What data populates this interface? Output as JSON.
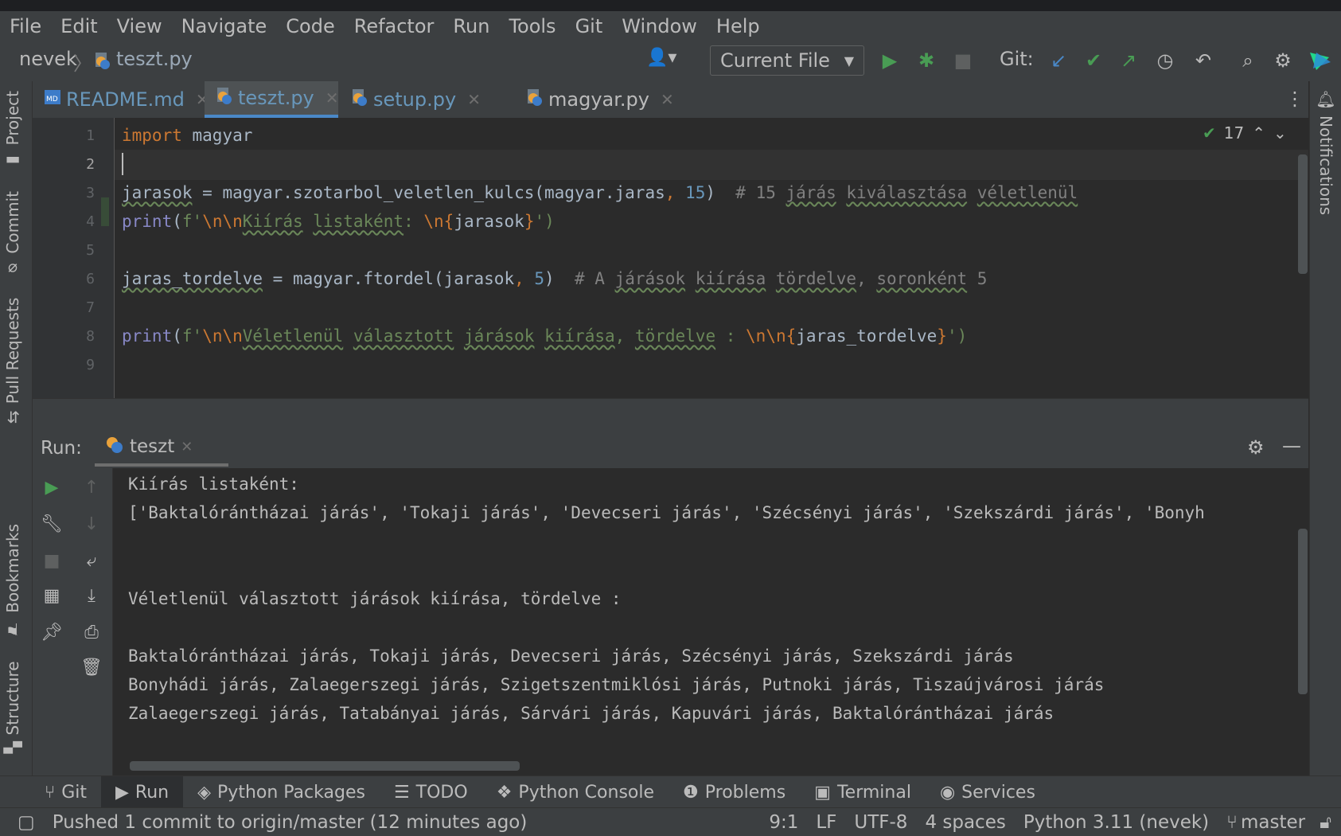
{
  "menu": [
    "File",
    "Edit",
    "View",
    "Navigate",
    "Code",
    "Refactor",
    "Run",
    "Tools",
    "Git",
    "Window",
    "Help"
  ],
  "nav": {
    "project": "nevek",
    "separator": "〉",
    "file": "teszt.py",
    "run_config": "Current File",
    "git_label": "Git:"
  },
  "side_tabs_left": [
    "Project",
    "Commit",
    "Pull Requests",
    "Bookmarks",
    "Structure"
  ],
  "side_tabs_right": [
    "Notifications"
  ],
  "editor_tabs": [
    {
      "label": "README.md",
      "active": false
    },
    {
      "label": "teszt.py",
      "active": true
    },
    {
      "label": "setup.py",
      "active": false
    },
    {
      "label": "magyar.py",
      "active": false
    }
  ],
  "inspection": {
    "count": "17"
  },
  "line_numbers": [
    "1",
    "2",
    "3",
    "4",
    "5",
    "6",
    "7",
    "8",
    "9"
  ],
  "code": {
    "l1_kw": "import",
    "l1_mod": " magyar",
    "l3_a": "jarasok",
    "l3_b": " = magyar.szotarbol_veletlen_kulcs(magyar.jaras",
    "l3_c": ", ",
    "l3_num": "15",
    "l3_d": ")  ",
    "l3_cm_a": "# 15 ",
    "l3_cm_b": "járás",
    "l3_cm_c": " ",
    "l3_cm_d": "kiválasztása",
    "l3_cm_e": " ",
    "l3_cm_f": "véletlenül",
    "l4_fn": "print",
    "l4_a": "(",
    "l4_f": "f",
    "l4_q": "'",
    "l4_esc": "\\n\\n",
    "l4_t1": "Kiírás",
    "l4_t2": " ",
    "l4_t3": "listaként",
    "l4_t4": ": ",
    "l4_esc2": "\\n",
    "l4_br1": "{",
    "l4_var": "jarasok",
    "l4_br2": "}",
    "l4_end": "')",
    "l6_a": "jaras_tordelve",
    "l6_b": " = magyar.ftordel(jarasok",
    "l6_c": ", ",
    "l6_num": "5",
    "l6_d": ")  ",
    "l6_cm_a": "# A ",
    "l6_cm_b": "járások",
    "l6_cm_c": " ",
    "l6_cm_d": "kiírása",
    "l6_cm_e": " ",
    "l6_cm_f": "tördelve",
    "l6_cm_g": ", ",
    "l6_cm_h": "soronként",
    "l6_cm_i": " 5",
    "l8_fn": "print",
    "l8_a": "(",
    "l8_f": "f",
    "l8_q": "'",
    "l8_esc": "\\n\\n",
    "l8_t1": "Véletlenül",
    "l8_t2": " ",
    "l8_t3": "választott",
    "l8_t4": " ",
    "l8_t5": "járások",
    "l8_t6": " ",
    "l8_t7": "kiírása",
    "l8_t8": ", ",
    "l8_t9": "tördelve",
    "l8_t10": " : ",
    "l8_esc2": "\\n\\n",
    "l8_br1": "{",
    "l8_var": "jaras_tordelve",
    "l8_br2": "}",
    "l8_end": "')"
  },
  "run": {
    "label": "Run:",
    "tab": "teszt",
    "output": [
      "Kiírás listaként:",
      "['Baktalórántházai járás', 'Tokaji járás', 'Devecseri járás', 'Szécsényi járás', 'Szekszárdi járás', 'Bonyh",
      "",
      "",
      "Véletlenül választott járások kiírása, tördelve :",
      "",
      "Baktalórántházai járás, Tokaji járás, Devecseri járás, Szécsényi járás, Szekszárdi járás",
      "Bonyhádi járás, Zalaegerszegi járás, Szigetszentmiklósi járás, Putnoki járás, Tiszaújvárosi járás",
      "Zalaegerszegi járás, Tatabányai járás, Sárvári járás, Kapuvári járás, Baktalórántházai járás"
    ]
  },
  "bottom_tabs": [
    {
      "label": "Git",
      "icon": "branch-icon"
    },
    {
      "label": "Run",
      "icon": "play-icon"
    },
    {
      "label": "Python Packages",
      "icon": "layers-icon"
    },
    {
      "label": "TODO",
      "icon": "list-icon"
    },
    {
      "label": "Python Console",
      "icon": "python-icon"
    },
    {
      "label": "Problems",
      "icon": "info-icon"
    },
    {
      "label": "Terminal",
      "icon": "terminal-icon"
    },
    {
      "label": "Services",
      "icon": "services-icon"
    }
  ],
  "status": {
    "message": "Pushed 1 commit to origin/master (12 minutes ago)",
    "position": "9:1",
    "line_sep": "LF",
    "encoding": "UTF-8",
    "indent": "4 spaces",
    "interpreter": "Python 3.11 (nevek)",
    "branch": "master"
  },
  "colors": {
    "accent": "#4a88c7",
    "run_green": "#499c54",
    "keyword": "#cc7832",
    "string": "#6a8759",
    "comment": "#808080",
    "number": "#6897bb"
  }
}
